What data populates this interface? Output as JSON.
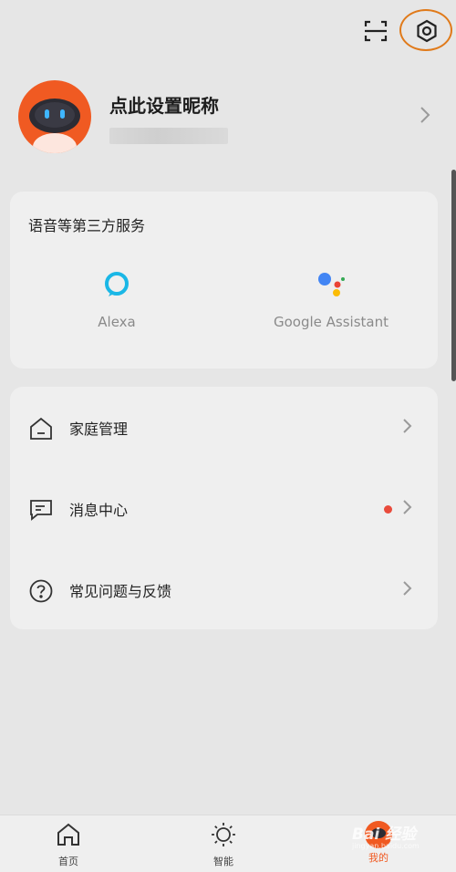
{
  "profile": {
    "nickname": "点此设置昵称"
  },
  "voice_services": {
    "title": "语音等第三方服务",
    "items": [
      {
        "label": "Alexa",
        "icon": "alexa-icon"
      },
      {
        "label": "Google Assistant",
        "icon": "google-assistant-icon"
      }
    ]
  },
  "menu": {
    "items": [
      {
        "label": "家庭管理",
        "icon": "home-outline-icon",
        "badge": false
      },
      {
        "label": "消息中心",
        "icon": "message-icon",
        "badge": true
      },
      {
        "label": "常见问题与反馈",
        "icon": "question-icon",
        "badge": false
      }
    ]
  },
  "tabs": [
    {
      "label": "首页",
      "icon": "home-icon"
    },
    {
      "label": "智能",
      "icon": "sun-icon"
    },
    {
      "label": "我的",
      "icon": "avatar-icon"
    }
  ],
  "watermark": {
    "text": "Bai 经验",
    "sub": "jingyan.baidu.com"
  },
  "colors": {
    "accent": "#f05a22",
    "highlight_ring": "#e07a1a",
    "badge": "#e94b3c",
    "alexa": "#1ab7e6",
    "background": "#e6e6e6"
  }
}
